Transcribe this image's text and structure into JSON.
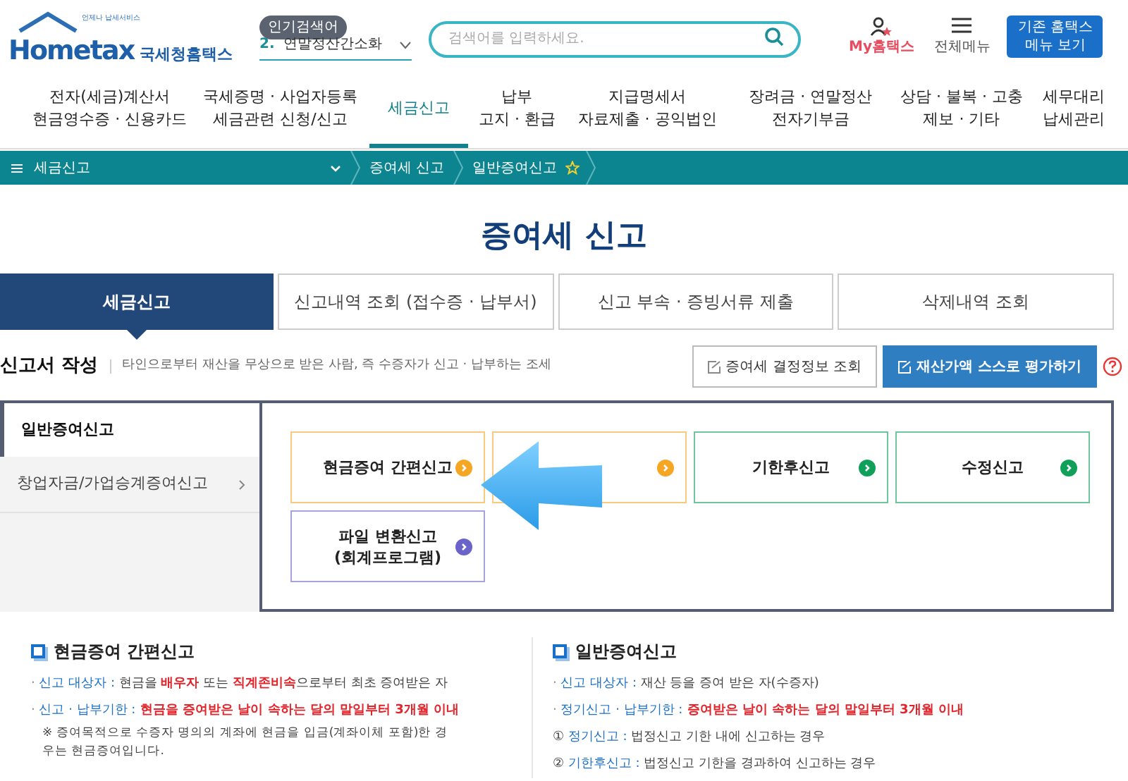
{
  "header": {
    "logo_text": "Hometax",
    "logo_tagline": "국세청홈택스",
    "logo_small": "언제나 납세서비스",
    "popular_badge": "인기검색어",
    "popular_rank": "2.",
    "popular_term": "연말정산간소화",
    "search": {
      "placeholder": "검색어를 입력하세요."
    },
    "my_label": "My홈택스",
    "menu_label": "전체메뉴",
    "classic_button": "기존 홈택스 메뉴 보기"
  },
  "nav": [
    {
      "lines": [
        "전자(세금)계산서",
        "현금영수증 · 신용카드"
      ],
      "selected": false
    },
    {
      "lines": [
        "국세증명 · 사업자등록",
        "세금관련 신청/신고"
      ],
      "selected": false
    },
    {
      "lines": [
        "세금신고"
      ],
      "selected": true
    },
    {
      "lines": [
        "납부",
        "고지 · 환급"
      ],
      "selected": false
    },
    {
      "lines": [
        "지급명세서",
        "자료제출 · 공익법인"
      ],
      "selected": false
    },
    {
      "lines": [
        "장려금 · 연말정산",
        "전자기부금"
      ],
      "selected": false
    },
    {
      "lines": [
        "상담 · 불복 · 고충",
        "제보 · 기타"
      ],
      "selected": false
    },
    {
      "lines": [
        "세무대리",
        "납세관리"
      ],
      "selected": false
    }
  ],
  "breadcrumb": {
    "menu": "세금신고",
    "items": [
      "증여세 신고",
      "일반증여신고"
    ]
  },
  "title": "증여세 신고",
  "tabs": [
    {
      "label": "세금신고",
      "selected": true
    },
    {
      "label": "신고내역 조회 (접수증 · 납부서)",
      "selected": false
    },
    {
      "label": "신고 부속 · 증빙서류 제출",
      "selected": false
    },
    {
      "label": "삭제내역 조회",
      "selected": false
    }
  ],
  "section": {
    "title": "신고서 작성",
    "description": "타인으로부터 재산을 무상으로 받은 사람, 즉 수증자가 신고 · 납부하는 조세",
    "buttons": [
      {
        "label": "증여세 결정정보 조회",
        "kind": "outline"
      },
      {
        "label": "재산가액 스스로 평가하기",
        "kind": "primary"
      }
    ]
  },
  "sidebar": [
    {
      "label": "일반증여신고",
      "selected": true
    },
    {
      "label": "창업자금/가업승계증여신고",
      "selected": false
    }
  ],
  "report_buttons": [
    {
      "lines": [
        "현금증여 간편신고"
      ],
      "color": "#f5a623"
    },
    {
      "color": "#f5a623"
    },
    {
      "lines": [
        "기한후신고"
      ],
      "color": "#11a05a"
    },
    {
      "lines": [
        "수정신고"
      ],
      "color": "#11a05a"
    },
    {
      "lines": [
        "파일 변환신고",
        "(회계프로그램)"
      ],
      "color": "#6b63c9"
    }
  ],
  "info": [
    {
      "title": "현금증여 간편신고",
      "lines": [
        {
          "kind": "bullet",
          "parts": [
            {
              "kind": "marker",
              "text": "· "
            },
            {
              "kind": "label",
              "text": "신고 대상자 :"
            },
            {
              "kind": "plain",
              "text": " 현금을 "
            },
            {
              "kind": "red",
              "text": "배우자"
            },
            {
              "kind": "plain",
              "text": " 또는 "
            },
            {
              "kind": "red",
              "text": "직계존비속"
            },
            {
              "kind": "plain",
              "text": "으로부터 최초 증여받은 자"
            }
          ]
        },
        {
          "kind": "bullet",
          "parts": [
            {
              "kind": "marker",
              "text": "· "
            },
            {
              "kind": "label",
              "text": "신고 · 납부기한 :"
            },
            {
              "kind": "red",
              "text": " 현금을 증여받은 날이 속하는 달의 말일부터 3개월 이내"
            }
          ]
        },
        {
          "kind": "note",
          "parts": [
            {
              "kind": "plain",
              "text": "※ 증여목적으로 수증자 명의의 계좌에 현금을 입금(계좌이체 포함)한 경우는 현금증여입니다."
            }
          ]
        }
      ]
    },
    {
      "title": "일반증여신고",
      "lines": [
        {
          "kind": "bullet",
          "parts": [
            {
              "kind": "marker",
              "text": "· "
            },
            {
              "kind": "label",
              "text": "신고 대상자 :"
            },
            {
              "kind": "plain",
              "text": " 재산 등을 증여 받은 자(수증자)"
            }
          ]
        },
        {
          "kind": "bullet",
          "parts": [
            {
              "kind": "marker",
              "text": "· "
            },
            {
              "kind": "label",
              "text": "정기신고 · 납부기한 :"
            },
            {
              "kind": "red",
              "text": " 증여받은 날이 속하는 달의 말일부터 3개월 이내"
            }
          ]
        },
        {
          "kind": "numbered",
          "parts": [
            {
              "kind": "plain",
              "text": "① "
            },
            {
              "kind": "label",
              "text": "정기신고 :"
            },
            {
              "kind": "plain",
              "text": " 법정신고 기한 내에 신고하는 경우"
            }
          ]
        },
        {
          "kind": "numbered",
          "parts": [
            {
              "kind": "plain",
              "text": "② "
            },
            {
              "kind": "label",
              "text": "기한후신고 :"
            },
            {
              "kind": "plain",
              "text": " 법정신고 기한을 경과하여 신고하는 경우"
            }
          ]
        }
      ]
    }
  ]
}
